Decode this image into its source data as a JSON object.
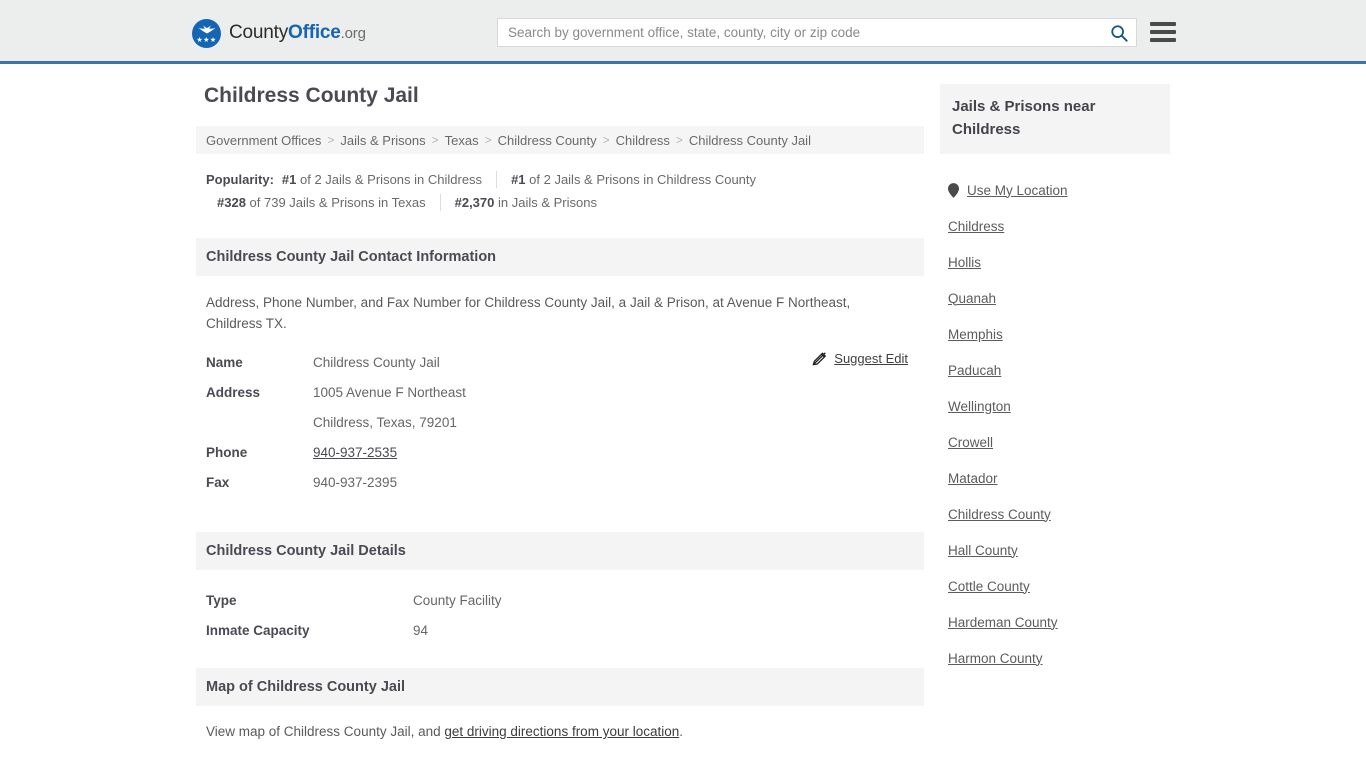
{
  "header": {
    "logo": {
      "text_part1": "County",
      "text_part2": "Office",
      "text_part3": ".org"
    },
    "search": {
      "placeholder": "Search by government office, state, county, city or zip code",
      "value": ""
    }
  },
  "page_title": "Childress County Jail",
  "breadcrumb": {
    "separator": ">",
    "items": [
      {
        "label": "Government Offices"
      },
      {
        "label": "Jails & Prisons"
      },
      {
        "label": "Texas"
      },
      {
        "label": "Childress County"
      },
      {
        "label": "Childress"
      },
      {
        "label": "Childress County Jail"
      }
    ]
  },
  "popularity": {
    "label": "Popularity:",
    "row1": [
      {
        "rank": "#1",
        "text": " of 2 Jails & Prisons in Childress"
      },
      {
        "rank": "#1",
        "text": " of 2 Jails & Prisons in Childress County"
      }
    ],
    "row2": [
      {
        "rank": "#328",
        "text": " of 739 Jails & Prisons in Texas"
      },
      {
        "rank": "#2,370",
        "text": " in Jails & Prisons"
      }
    ]
  },
  "contact_section": {
    "heading": "Childress County Jail Contact Information",
    "intro": "Address, Phone Number, and Fax Number for Childress County Jail, a Jail & Prison, at Avenue F Northeast, Childress TX.",
    "suggest_edit": "Suggest Edit",
    "rows": [
      {
        "key": "Name",
        "value": "Childress County Jail",
        "link": false
      },
      {
        "key": "Address",
        "value": "1005 Avenue F Northeast",
        "link": false
      },
      {
        "key": "",
        "value": "Childress, Texas, 79201",
        "link": false
      },
      {
        "key": "Phone",
        "value": "940-937-2535",
        "link": true
      },
      {
        "key": "Fax",
        "value": "940-937-2395",
        "link": false
      }
    ]
  },
  "details_section": {
    "heading": "Childress County Jail Details",
    "rows": [
      {
        "key": "Type",
        "value": "County Facility"
      },
      {
        "key": "Inmate Capacity",
        "value": "94"
      }
    ]
  },
  "map_section": {
    "heading": "Map of Childress County Jail",
    "note_prefix": "View map of Childress County Jail, and ",
    "note_link": "get driving directions from your location",
    "note_suffix": "."
  },
  "sidebar": {
    "heading": "Jails & Prisons near Childress",
    "use_my_location": "Use My Location",
    "items": [
      {
        "label": "Childress"
      },
      {
        "label": "Hollis"
      },
      {
        "label": "Quanah"
      },
      {
        "label": "Memphis"
      },
      {
        "label": "Paducah"
      },
      {
        "label": "Wellington"
      },
      {
        "label": "Crowell"
      },
      {
        "label": "Matador"
      },
      {
        "label": "Childress County"
      },
      {
        "label": "Hall County"
      },
      {
        "label": "Cottle County"
      },
      {
        "label": "Hardeman County"
      },
      {
        "label": "Harmon County"
      }
    ]
  },
  "colors": {
    "brand_blue": "#1565b5",
    "header_border": "#3a73a8",
    "header_bg": "#eceded",
    "section_bg": "#f4f4f4"
  }
}
